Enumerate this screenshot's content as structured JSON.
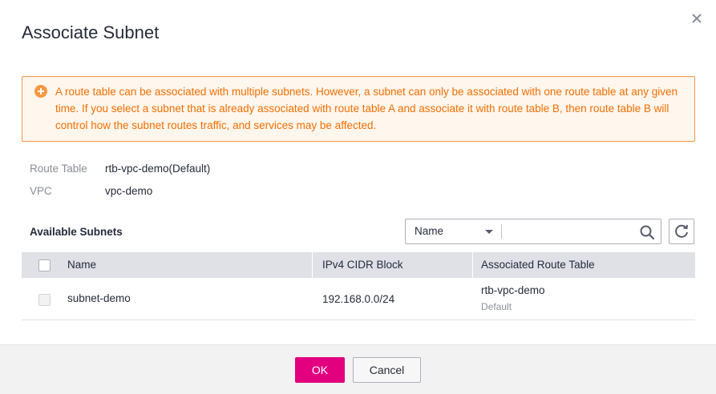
{
  "dialog": {
    "title": "Associate Subnet",
    "close_icon": "close-icon"
  },
  "alert": {
    "icon": "warning-plus-icon",
    "color": "#fa9841",
    "text": "A route table can be associated with multiple subnets. However, a subnet can only be associated with one route table at any given time. If you select a subnet that is already associated with route table A and associate it with route table B, then route table B will control how the subnet routes traffic, and services may be affected."
  },
  "info": {
    "route_table_label": "Route Table",
    "route_table_value": "rtb-vpc-demo(Default)",
    "vpc_label": "VPC",
    "vpc_value": "vpc-demo"
  },
  "subnets": {
    "section_title": "Available Subnets",
    "filter": {
      "selected": "Name",
      "search_value": "",
      "search_icon": "search-icon"
    },
    "refresh_icon": "refresh-icon",
    "columns": [
      "Name",
      "IPv4 CIDR Block",
      "Associated Route Table"
    ],
    "rows": [
      {
        "name": "subnet-demo",
        "cidr": "192.168.0.0/24",
        "route_table": "rtb-vpc-demo",
        "route_table_tag": "Default",
        "checked": false,
        "disabled": true
      }
    ]
  },
  "footer": {
    "ok_label": "OK",
    "cancel_label": "Cancel",
    "primary_color": "#e3007f"
  }
}
